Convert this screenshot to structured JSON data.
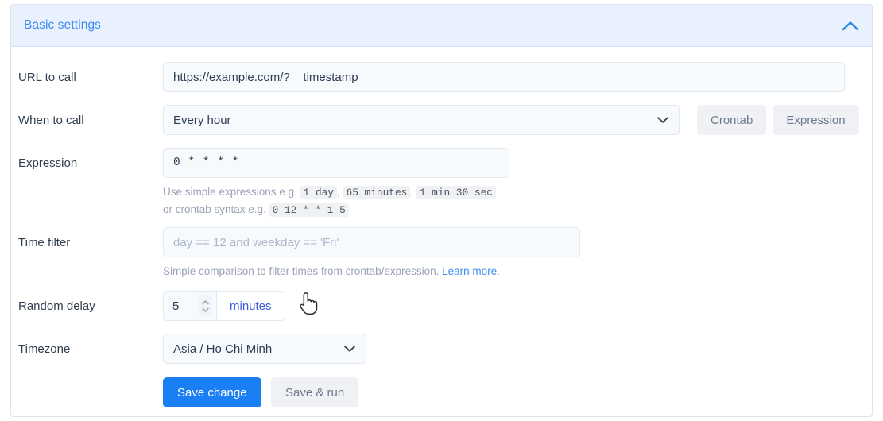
{
  "panel": {
    "title": "Basic settings",
    "collapse_icon": "chevron-up-icon",
    "accent_color": "#3d8bf2",
    "header_bg": "#e8f1fd"
  },
  "fields": {
    "url": {
      "label": "URL to call",
      "value": "https://example.com/?__timestamp__"
    },
    "when": {
      "label": "When to call",
      "value": "Every hour",
      "dropdown_icon": "chevron-down-icon",
      "buttons": [
        {
          "label": "Crontab",
          "name": "crontab-button"
        },
        {
          "label": "Expression",
          "name": "expression-button"
        }
      ]
    },
    "expression": {
      "label": "Expression",
      "value": "0 * * * *",
      "hint_line1_prefix": "Use simple expressions e.g.",
      "hint_codes_line1": [
        "1 day",
        "65 minutes",
        "1 min 30 sec"
      ],
      "hint_line2_prefix": "or crontab syntax e.g.",
      "hint_code_line2": "0 12 * * 1-5"
    },
    "time_filter": {
      "label": "Time filter",
      "placeholder": "day == 12 and weekday == 'Fri'",
      "value": "",
      "hint_text": "Simple comparison to filter times from crontab/expression.",
      "hint_link": "Learn more",
      "hint_suffix": "."
    },
    "random_delay": {
      "label": "Random delay",
      "value": "5",
      "unit": "minutes",
      "stepper_icon": "updown-arrows-icon"
    },
    "timezone": {
      "label": "Timezone",
      "value": "Asia / Ho Chi Minh",
      "dropdown_icon": "chevron-down-icon"
    }
  },
  "actions": {
    "primary": "Save change",
    "secondary": "Save & run",
    "primary_color": "#1a7ef5"
  },
  "cursor": {
    "icon": "pointing-hand-cursor"
  }
}
